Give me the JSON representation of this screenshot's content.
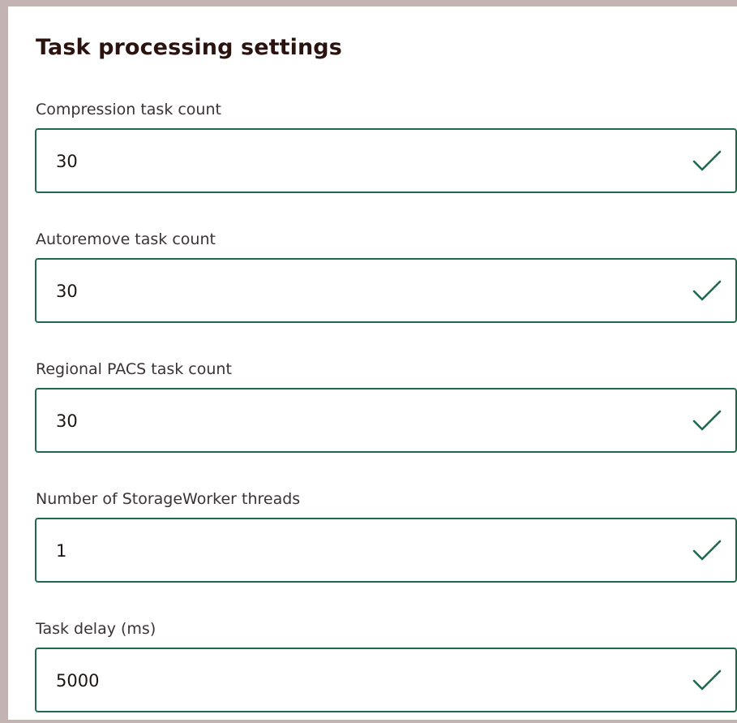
{
  "panel": {
    "title": "Task processing settings"
  },
  "fields": [
    {
      "label": "Compression task count",
      "value": "30",
      "icon": "check-icon"
    },
    {
      "label": "Autoremove task count",
      "value": "30",
      "icon": "check-icon"
    },
    {
      "label": "Regional PACS task count",
      "value": "30",
      "icon": "check-icon"
    },
    {
      "label": "Number of StorageWorker threads",
      "value": "1",
      "icon": "check-icon"
    },
    {
      "label": "Task delay (ms)",
      "value": "5000",
      "icon": "check-icon"
    }
  ],
  "colors": {
    "valid_border": "#1f6a4c",
    "check_mark": "#1f6a4c",
    "frame": "#c3b4b1"
  }
}
